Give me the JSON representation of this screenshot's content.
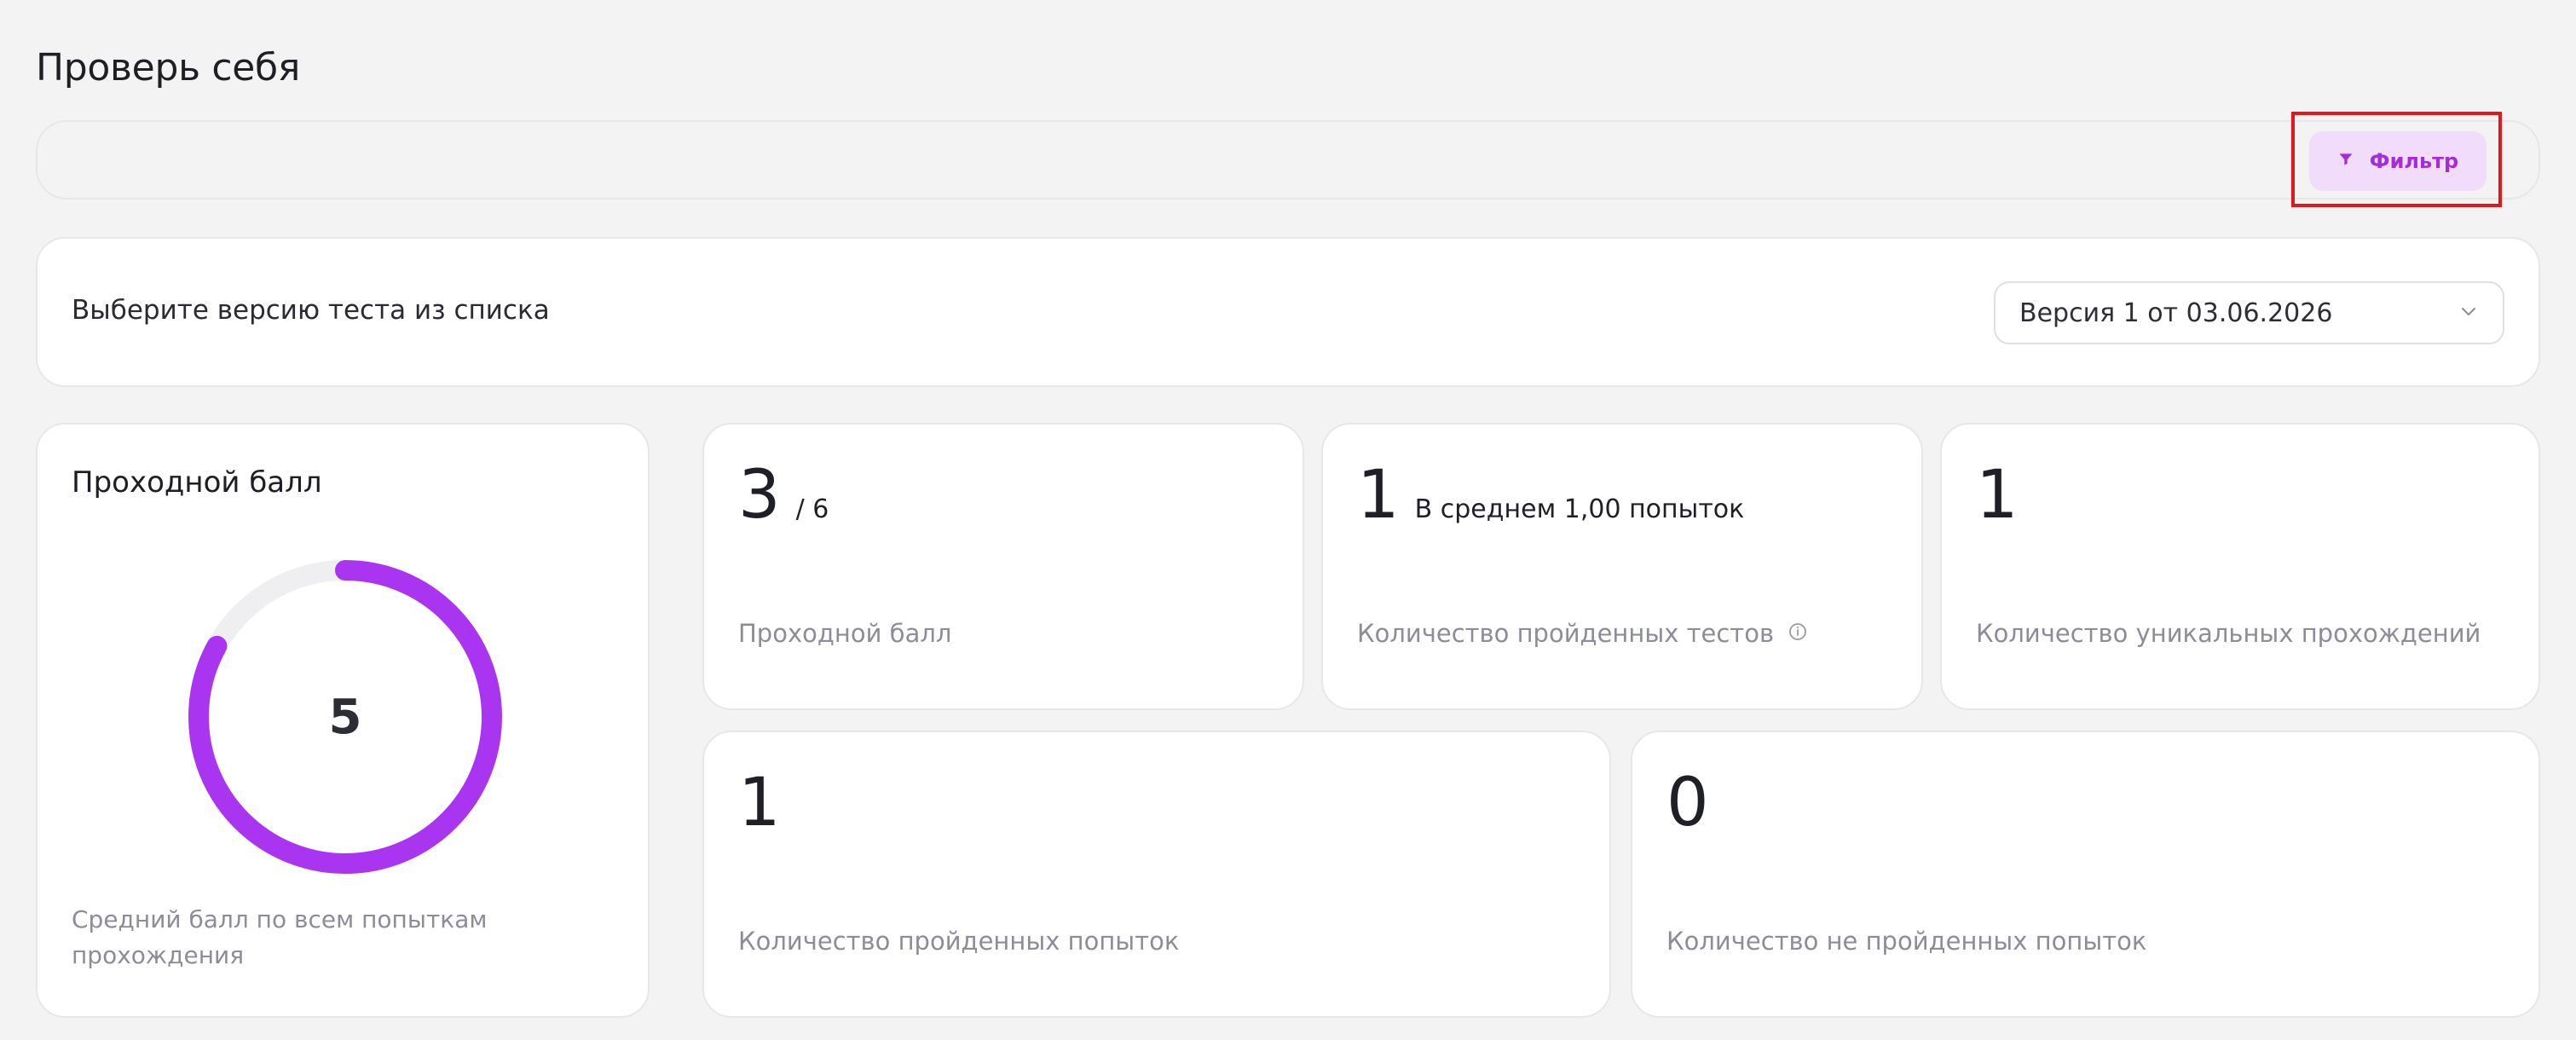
{
  "page": {
    "title": "Проверь себя"
  },
  "filter": {
    "label": "Фильтр",
    "icon": "filter-icon",
    "accent": "#a32ddb",
    "background": "#f1dcfb"
  },
  "version": {
    "label": "Выберите версию теста из списка",
    "selected": "Версия 1 от 03.06.2026",
    "icon": "chevron-down-icon"
  },
  "pass_score": {
    "title": "Проходной балл",
    "value": "5",
    "progress_fraction": 0.83,
    "caption": "Средний балл по всем попыткам прохождения",
    "ring_color": "#aa35f0",
    "ring_track_color": "#efeff2"
  },
  "metrics": {
    "pass_score": {
      "value": "3",
      "suffix": "/ 6",
      "caption": "Проходной балл"
    },
    "completed_tests": {
      "value": "1",
      "suffix": "В среднем 1,00 попыток",
      "caption": "Количество пройденных тестов",
      "icon": "info-icon"
    },
    "unique_passes": {
      "value": "1",
      "caption": "Количество уникальных прохождений"
    },
    "passed_attempts": {
      "value": "1",
      "caption": "Количество пройденных попыток"
    },
    "failed_attempts": {
      "value": "0",
      "caption": "Количество не пройденных попыток"
    }
  }
}
